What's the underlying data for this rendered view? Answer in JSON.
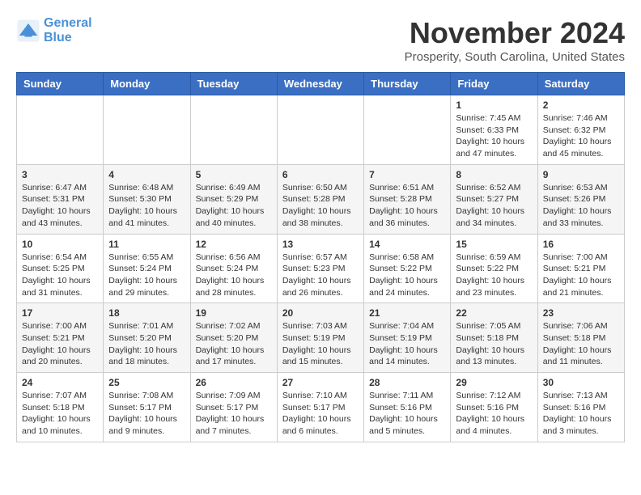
{
  "header": {
    "logo_line1": "General",
    "logo_line2": "Blue",
    "month_title": "November 2024",
    "location": "Prosperity, South Carolina, United States"
  },
  "days_of_week": [
    "Sunday",
    "Monday",
    "Tuesday",
    "Wednesday",
    "Thursday",
    "Friday",
    "Saturday"
  ],
  "weeks": [
    [
      {
        "day": "",
        "info": ""
      },
      {
        "day": "",
        "info": ""
      },
      {
        "day": "",
        "info": ""
      },
      {
        "day": "",
        "info": ""
      },
      {
        "day": "",
        "info": ""
      },
      {
        "day": "1",
        "info": "Sunrise: 7:45 AM\nSunset: 6:33 PM\nDaylight: 10 hours and 47 minutes."
      },
      {
        "day": "2",
        "info": "Sunrise: 7:46 AM\nSunset: 6:32 PM\nDaylight: 10 hours and 45 minutes."
      }
    ],
    [
      {
        "day": "3",
        "info": "Sunrise: 6:47 AM\nSunset: 5:31 PM\nDaylight: 10 hours and 43 minutes."
      },
      {
        "day": "4",
        "info": "Sunrise: 6:48 AM\nSunset: 5:30 PM\nDaylight: 10 hours and 41 minutes."
      },
      {
        "day": "5",
        "info": "Sunrise: 6:49 AM\nSunset: 5:29 PM\nDaylight: 10 hours and 40 minutes."
      },
      {
        "day": "6",
        "info": "Sunrise: 6:50 AM\nSunset: 5:28 PM\nDaylight: 10 hours and 38 minutes."
      },
      {
        "day": "7",
        "info": "Sunrise: 6:51 AM\nSunset: 5:28 PM\nDaylight: 10 hours and 36 minutes."
      },
      {
        "day": "8",
        "info": "Sunrise: 6:52 AM\nSunset: 5:27 PM\nDaylight: 10 hours and 34 minutes."
      },
      {
        "day": "9",
        "info": "Sunrise: 6:53 AM\nSunset: 5:26 PM\nDaylight: 10 hours and 33 minutes."
      }
    ],
    [
      {
        "day": "10",
        "info": "Sunrise: 6:54 AM\nSunset: 5:25 PM\nDaylight: 10 hours and 31 minutes."
      },
      {
        "day": "11",
        "info": "Sunrise: 6:55 AM\nSunset: 5:24 PM\nDaylight: 10 hours and 29 minutes."
      },
      {
        "day": "12",
        "info": "Sunrise: 6:56 AM\nSunset: 5:24 PM\nDaylight: 10 hours and 28 minutes."
      },
      {
        "day": "13",
        "info": "Sunrise: 6:57 AM\nSunset: 5:23 PM\nDaylight: 10 hours and 26 minutes."
      },
      {
        "day": "14",
        "info": "Sunrise: 6:58 AM\nSunset: 5:22 PM\nDaylight: 10 hours and 24 minutes."
      },
      {
        "day": "15",
        "info": "Sunrise: 6:59 AM\nSunset: 5:22 PM\nDaylight: 10 hours and 23 minutes."
      },
      {
        "day": "16",
        "info": "Sunrise: 7:00 AM\nSunset: 5:21 PM\nDaylight: 10 hours and 21 minutes."
      }
    ],
    [
      {
        "day": "17",
        "info": "Sunrise: 7:00 AM\nSunset: 5:21 PM\nDaylight: 10 hours and 20 minutes."
      },
      {
        "day": "18",
        "info": "Sunrise: 7:01 AM\nSunset: 5:20 PM\nDaylight: 10 hours and 18 minutes."
      },
      {
        "day": "19",
        "info": "Sunrise: 7:02 AM\nSunset: 5:20 PM\nDaylight: 10 hours and 17 minutes."
      },
      {
        "day": "20",
        "info": "Sunrise: 7:03 AM\nSunset: 5:19 PM\nDaylight: 10 hours and 15 minutes."
      },
      {
        "day": "21",
        "info": "Sunrise: 7:04 AM\nSunset: 5:19 PM\nDaylight: 10 hours and 14 minutes."
      },
      {
        "day": "22",
        "info": "Sunrise: 7:05 AM\nSunset: 5:18 PM\nDaylight: 10 hours and 13 minutes."
      },
      {
        "day": "23",
        "info": "Sunrise: 7:06 AM\nSunset: 5:18 PM\nDaylight: 10 hours and 11 minutes."
      }
    ],
    [
      {
        "day": "24",
        "info": "Sunrise: 7:07 AM\nSunset: 5:18 PM\nDaylight: 10 hours and 10 minutes."
      },
      {
        "day": "25",
        "info": "Sunrise: 7:08 AM\nSunset: 5:17 PM\nDaylight: 10 hours and 9 minutes."
      },
      {
        "day": "26",
        "info": "Sunrise: 7:09 AM\nSunset: 5:17 PM\nDaylight: 10 hours and 7 minutes."
      },
      {
        "day": "27",
        "info": "Sunrise: 7:10 AM\nSunset: 5:17 PM\nDaylight: 10 hours and 6 minutes."
      },
      {
        "day": "28",
        "info": "Sunrise: 7:11 AM\nSunset: 5:16 PM\nDaylight: 10 hours and 5 minutes."
      },
      {
        "day": "29",
        "info": "Sunrise: 7:12 AM\nSunset: 5:16 PM\nDaylight: 10 hours and 4 minutes."
      },
      {
        "day": "30",
        "info": "Sunrise: 7:13 AM\nSunset: 5:16 PM\nDaylight: 10 hours and 3 minutes."
      }
    ]
  ]
}
